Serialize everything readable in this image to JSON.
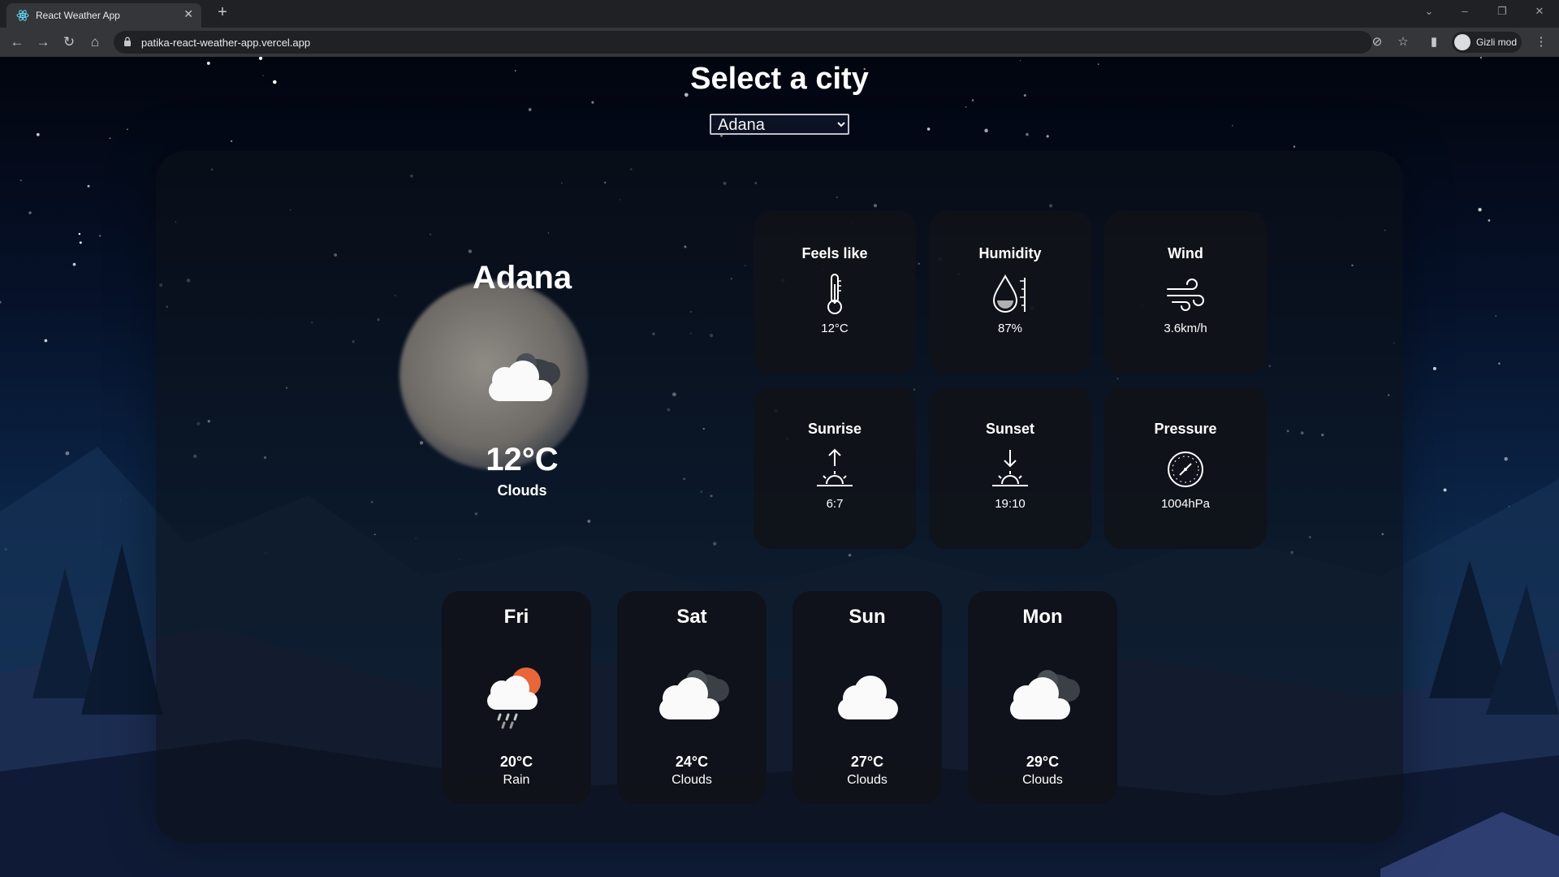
{
  "browser": {
    "tab_title": "React Weather App",
    "url": "patika-react-weather-app.vercel.app",
    "profile_label": "Gizli mod"
  },
  "page": {
    "title": "Select a city",
    "selected_city": "Adana"
  },
  "current": {
    "city": "Adana",
    "temperature": "12°C",
    "description": "Clouds",
    "icon": "cloud-icon"
  },
  "details": [
    {
      "label": "Feels like",
      "value": "12°C",
      "icon": "thermometer-icon"
    },
    {
      "label": "Humidity",
      "value": "87%",
      "icon": "humidity-icon"
    },
    {
      "label": "Wind",
      "value": "3.6km/h",
      "icon": "wind-icon"
    },
    {
      "label": "Sunrise",
      "value": "6:7",
      "icon": "sunrise-icon"
    },
    {
      "label": "Sunset",
      "value": "19:10",
      "icon": "sunset-icon"
    },
    {
      "label": "Pressure",
      "value": "1004hPa",
      "icon": "pressure-gauge-icon"
    }
  ],
  "forecast": [
    {
      "day": "Fri",
      "temperature": "20°C",
      "description": "Rain",
      "icon": "rain-sun-cloud-icon"
    },
    {
      "day": "Sat",
      "temperature": "24°C",
      "description": "Clouds",
      "icon": "clouds-icon"
    },
    {
      "day": "Sun",
      "temperature": "27°C",
      "description": "Clouds",
      "icon": "cloud-icon"
    },
    {
      "day": "Mon",
      "temperature": "29°C",
      "description": "Clouds",
      "icon": "clouds-icon"
    }
  ],
  "colors": {
    "card_bg": "#101218",
    "sun_accent": "#e8663a"
  }
}
